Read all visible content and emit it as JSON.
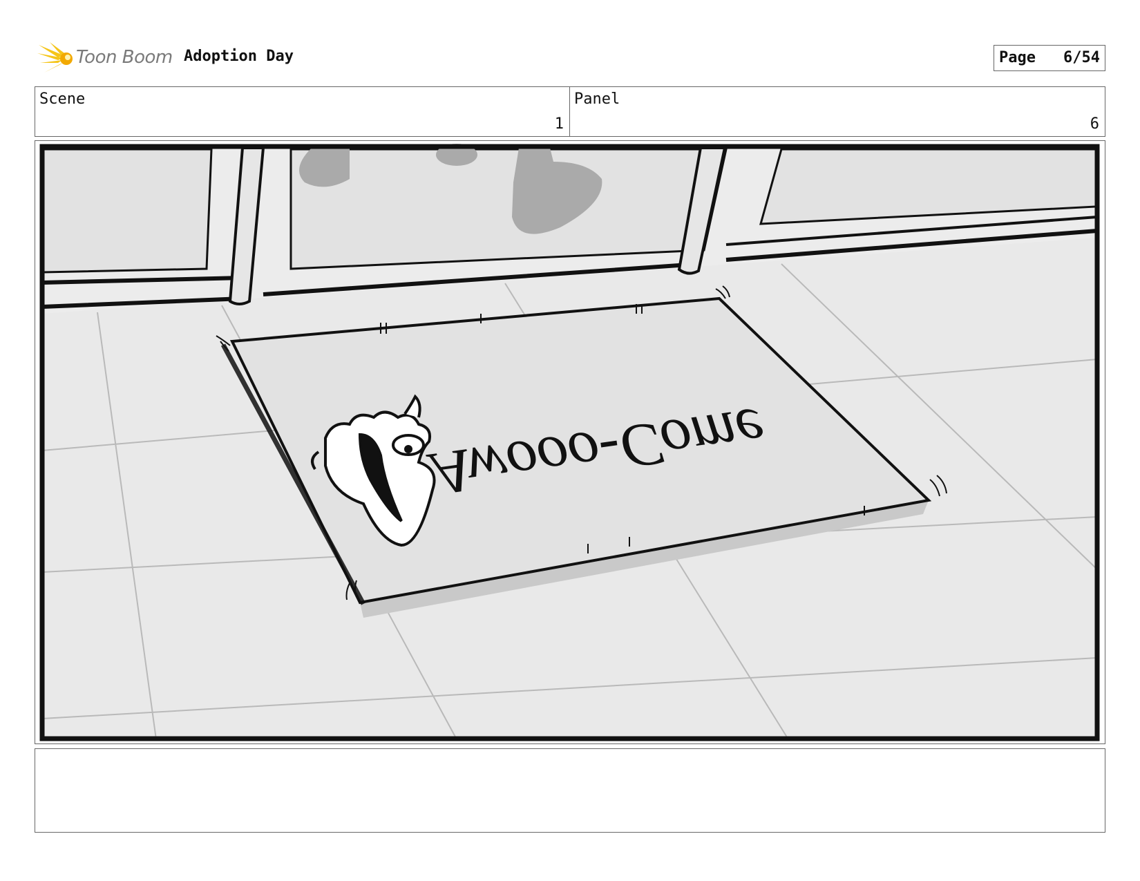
{
  "header": {
    "logo_text": "Toon Boom",
    "title": "Adoption Day",
    "page_label": "Page",
    "page_value": "6/54"
  },
  "info": {
    "scene_label": "Scene",
    "scene_value": "1",
    "panel_label": "Panel",
    "panel_value": "6"
  },
  "panel_image": {
    "mat_text": "Awooo-Come",
    "icons": [
      "toon-boom-logo-icon",
      "dog-head-icon"
    ]
  },
  "notes": {
    "text": ""
  }
}
